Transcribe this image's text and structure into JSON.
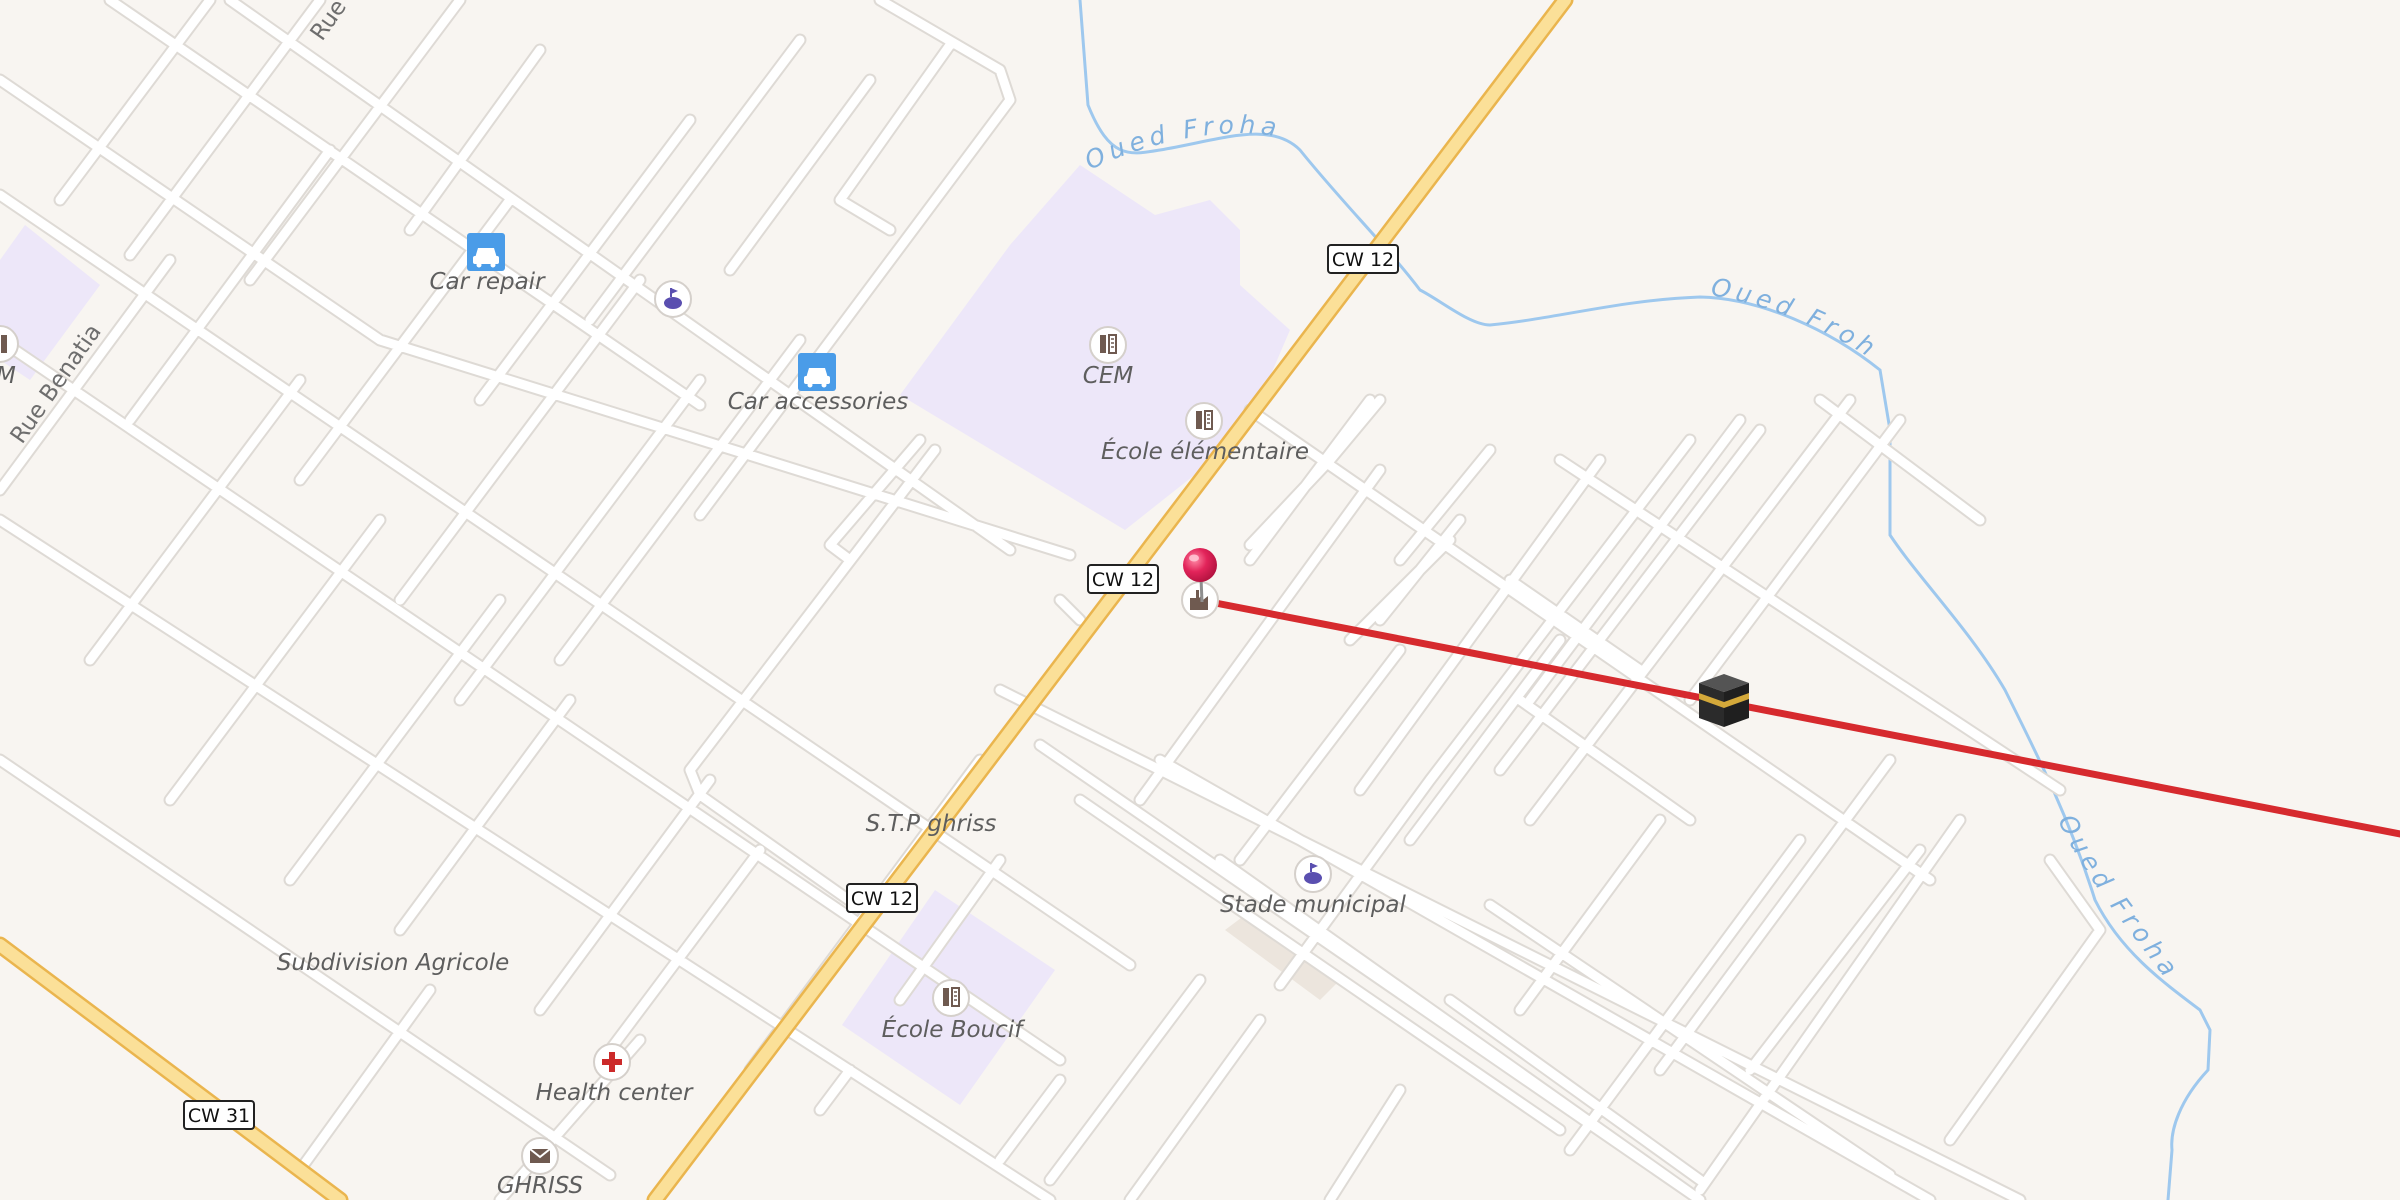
{
  "map": {
    "colors": {
      "background": "#f8f5f1",
      "minor_road": "#ffffff",
      "minor_road_casing": "#dedad5",
      "primary_road": "#fbe098",
      "primary_road_casing": "#eab54e",
      "school_area": "#ede7f9",
      "river": "#9ec8ee",
      "river_label": "#7fb0de",
      "route_line": "#d62a2e",
      "pin": "#e2245a",
      "icon_brown": "#6f5a50",
      "repair_icon_bg": "#4a9ce8",
      "health_cross": "#cc2a2a"
    },
    "roads": {
      "cw12_labels": [
        "CW 12",
        "CW 12",
        "CW 12"
      ],
      "cw31_label": "CW 31",
      "rue_benatia": "Rue Benatia",
      "rue_partial": "Rue"
    },
    "rivers": {
      "labels": [
        "Oued Froha",
        "Oued Froha",
        "Oued Froha"
      ]
    },
    "pois": {
      "car_repair": {
        "label": "Car repair",
        "icon": "car-icon"
      },
      "car_accessories": {
        "label": "Car accessories",
        "icon": "car-icon"
      },
      "cem": {
        "label": "CEM",
        "icon": "school-icon"
      },
      "ecole_elementaire": {
        "label": "École élémentaire",
        "icon": "school-icon"
      },
      "sports_top": {
        "icon": "stadium-icon"
      },
      "stade_municipal": {
        "label": "Stade municipal",
        "icon": "stadium-icon"
      },
      "stp_ghriss": {
        "label": "S.T.P ghriss"
      },
      "subdivision_agricole": {
        "label": "Subdivision Agricole"
      },
      "ecole_boucif": {
        "label": "École Boucif",
        "icon": "school-icon"
      },
      "health_center": {
        "label": "Health center",
        "icon": "health-cross-icon"
      },
      "ghriss": {
        "label": "GHRISS",
        "icon": "post-office-icon"
      },
      "left_school_partial": {
        "label": "M",
        "icon": "school-icon"
      },
      "factory": {
        "icon": "factory-icon"
      }
    },
    "markers": {
      "location_pin": {
        "icon": "location-pin-icon"
      },
      "qibla": {
        "icon": "kaaba-icon"
      }
    }
  }
}
